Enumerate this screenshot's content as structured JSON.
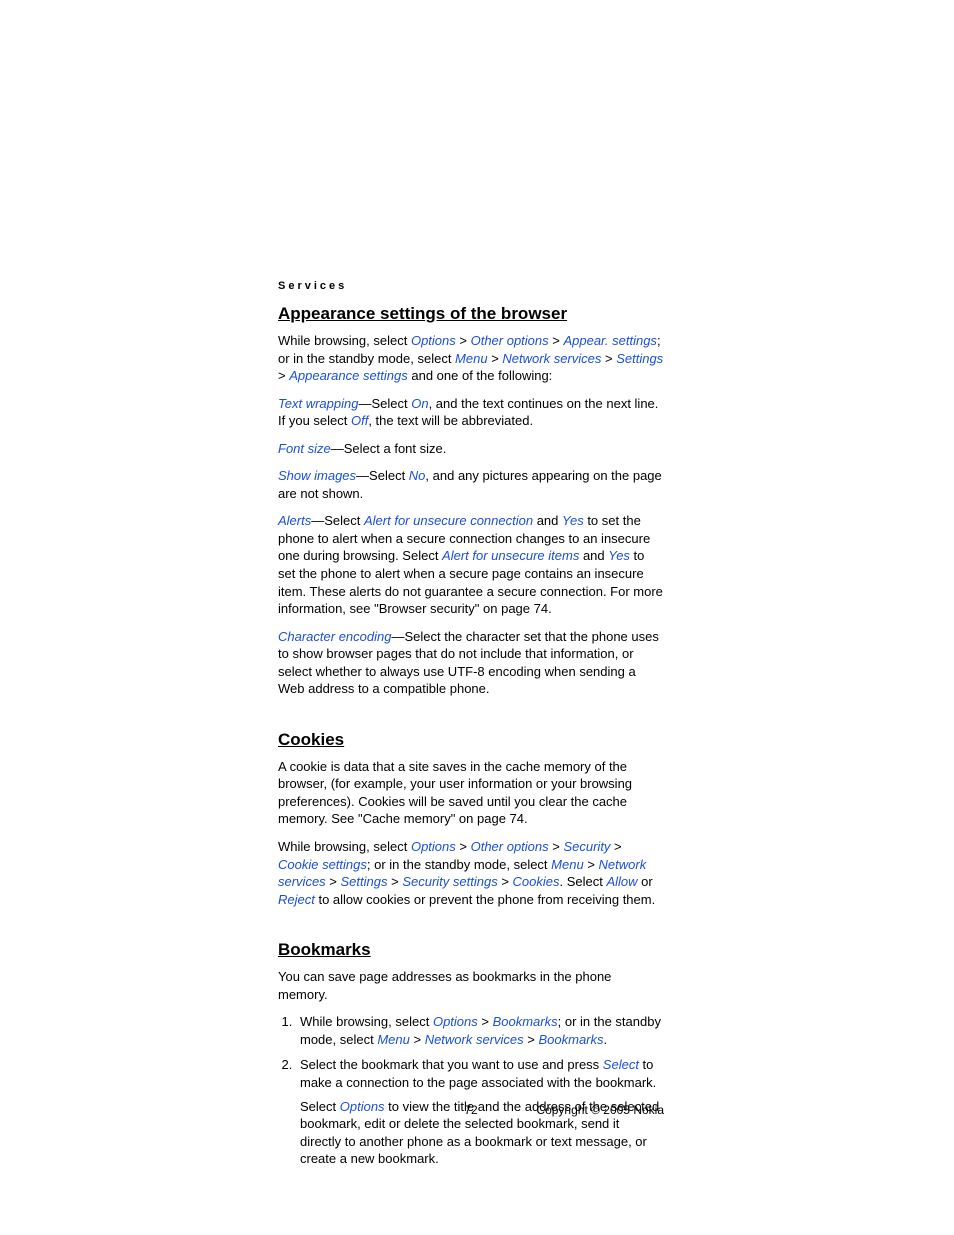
{
  "header": "Services",
  "sections": {
    "appearance": {
      "title": "Appearance settings of the browser",
      "p1_a": "While browsing, select ",
      "p1_options": "Options",
      "p1_gt1": " > ",
      "p1_other": "Other options",
      "p1_gt2": " > ",
      "p1_appear": "Appear. settings",
      "p1_b": "; or in the standby mode, select ",
      "p1_menu": "Menu",
      "p1_gt3": " > ",
      "p1_net": "Network services",
      "p1_gt4": " > ",
      "p1_settings": "Settings",
      "p1_gt5": " > ",
      "p1_appsettings": "Appearance settings",
      "p1_c": " and one of the following:",
      "tw_label": "Text wrapping",
      "tw_a": "—Select ",
      "tw_on": "On",
      "tw_b": ", and the text continues on the next line. If you select ",
      "tw_off": "Off",
      "tw_c": ", the text will be abbreviated.",
      "fs_label": "Font size",
      "fs_text": "—Select a font size.",
      "si_label": "Show images",
      "si_a": "—Select ",
      "si_no": "No",
      "si_b": ", and any pictures appearing on the page are not shown.",
      "al_label": "Alerts",
      "al_a": "—Select ",
      "al_unsec": "Alert for unsecure connection",
      "al_b": " and ",
      "al_yes1": "Yes",
      "al_c": " to set the phone to alert when a secure connection changes to an insecure one during browsing. Select ",
      "al_items": "Alert for unsecure items",
      "al_d": " and ",
      "al_yes2": "Yes",
      "al_e": " to set the phone to alert when a secure page contains an insecure item. These alerts do not guarantee a secure connection. For more information, see \"Browser security\" on page 74.",
      "ce_label": "Character encoding",
      "ce_text": "—Select the character set that the phone uses to show browser pages that do not include that information, or select whether to always use UTF-8 encoding when sending a Web address to a compatible phone."
    },
    "cookies": {
      "title": "Cookies",
      "p1": "A cookie is data that a site saves in the cache memory of the browser, (for example, your user information or your browsing preferences). Cookies will be saved until you clear the cache memory. See \"Cache memory\" on page 74.",
      "p2_a": "While browsing, select ",
      "p2_options": "Options",
      "p2_gt1": " > ",
      "p2_other": "Other options",
      "p2_gt2": " > ",
      "p2_sec": "Security",
      "p2_gt3": " > ",
      "p2_cookieset": "Cookie settings",
      "p2_b": "; or in the standby mode, select ",
      "p2_menu": "Menu",
      "p2_gt4": " > ",
      "p2_net": "Network services",
      "p2_gt5": " > ",
      "p2_settings": "Settings",
      "p2_gt6": " > ",
      "p2_secset": "Security settings",
      "p2_gt7": " > ",
      "p2_cookies": "Cookies",
      "p2_c": ". Select ",
      "p2_allow": "Allow",
      "p2_d": " or ",
      "p2_reject": "Reject",
      "p2_e": " to allow cookies or prevent the phone from receiving them."
    },
    "bookmarks": {
      "title": "Bookmarks",
      "p1": "You can save page addresses as bookmarks in the phone memory.",
      "li1_a": "While browsing, select ",
      "li1_options": "Options",
      "li1_gt1": " > ",
      "li1_bm1": "Bookmarks",
      "li1_b": "; or in the standby mode, select ",
      "li1_menu": "Menu",
      "li1_gt2": " > ",
      "li1_net": "Network services",
      "li1_gt3": " > ",
      "li1_bm2": "Bookmarks",
      "li1_c": ".",
      "li2_a": "Select the bookmark that you want to use and press ",
      "li2_select": "Select",
      "li2_b": " to make a connection to the page associated with the bookmark.",
      "li2_sub_a": "Select ",
      "li2_sub_opt": "Options",
      "li2_sub_b": " to view the title and the address of the selected bookmark, edit or delete the selected bookmark, send it directly to another phone as a bookmark or text message, or create a new bookmark."
    }
  },
  "footer": {
    "page": "72",
    "copyright": "Copyright © 2005 Nokia"
  }
}
